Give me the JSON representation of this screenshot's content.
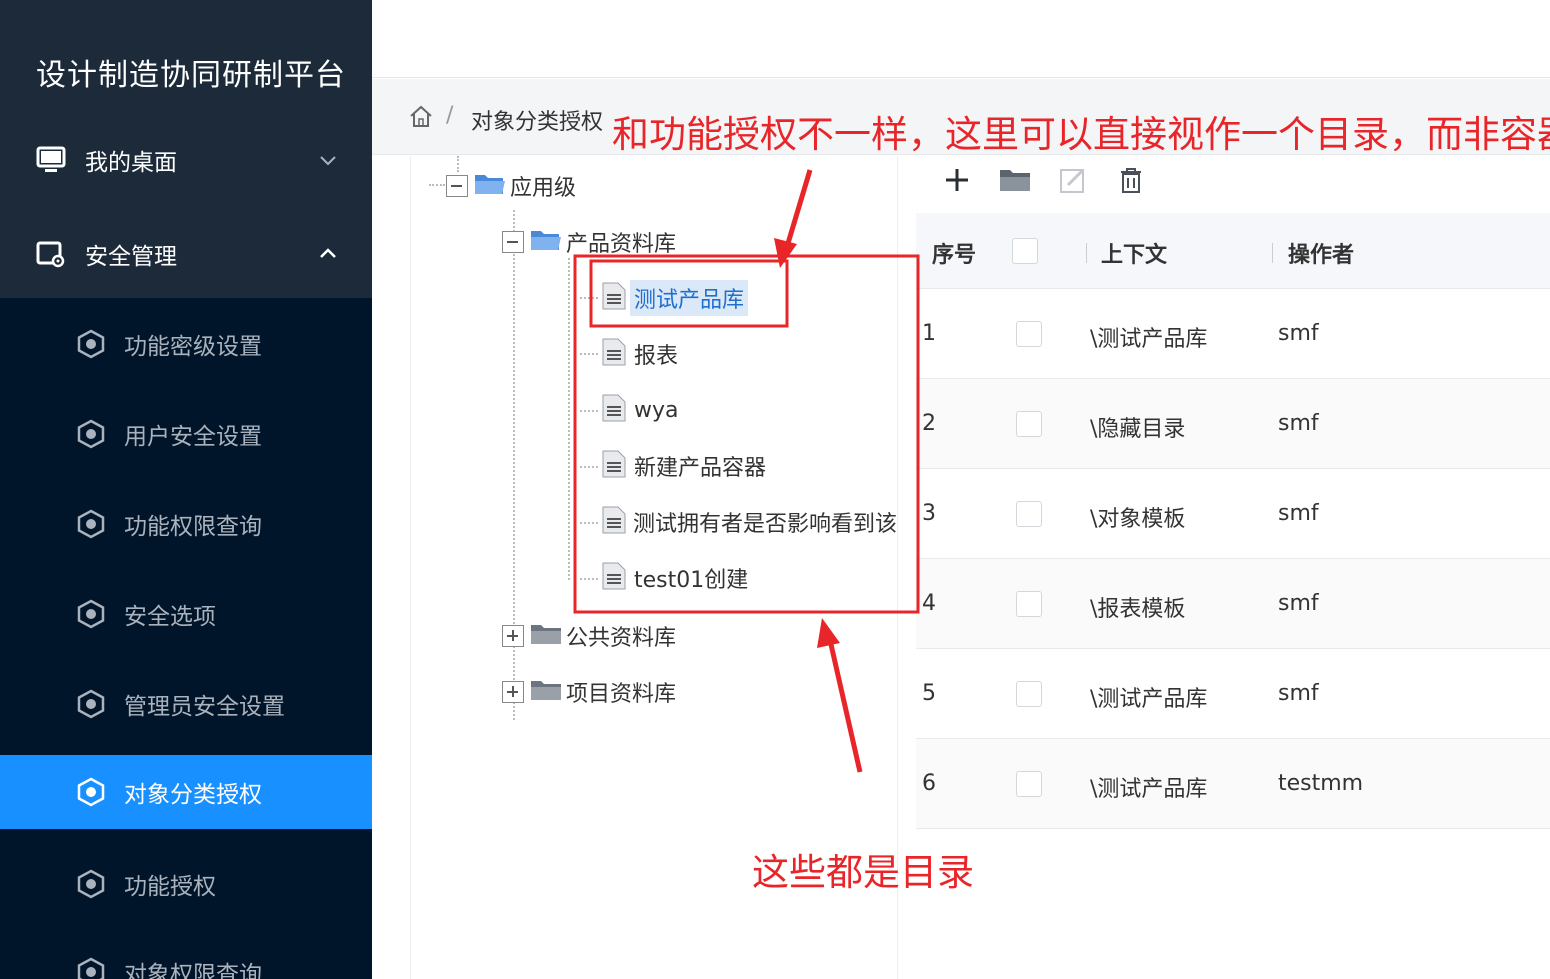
{
  "sidebar": {
    "app_title": "设计制造协同研制平台",
    "groups": [
      {
        "label": "我的桌面",
        "icon": "monitor-icon",
        "state": "collapsed"
      },
      {
        "label": "安全管理",
        "icon": "security-settings-icon",
        "state": "expanded"
      }
    ],
    "items": [
      {
        "label": "功能密级设置",
        "icon": "hexagon-icon",
        "active": false
      },
      {
        "label": "用户安全设置",
        "icon": "hexagon-icon",
        "active": false
      },
      {
        "label": "功能权限查询",
        "icon": "hexagon-icon",
        "active": false
      },
      {
        "label": "安全选项",
        "icon": "hexagon-icon",
        "active": false
      },
      {
        "label": "管理员安全设置",
        "icon": "hexagon-icon",
        "active": false
      },
      {
        "label": "对象分类授权",
        "icon": "hexagon-icon",
        "active": true
      },
      {
        "label": "功能授权",
        "icon": "hexagon-icon",
        "active": false
      },
      {
        "label": "对象权限查询",
        "icon": "hexagon-icon",
        "active": false
      }
    ],
    "active_color": "#1890ff"
  },
  "breadcrumb": {
    "home_icon": "home-icon",
    "separator": "/",
    "current": "对象分类授权"
  },
  "tree": {
    "root": {
      "label": "应用级",
      "icon": "folder-open-icon",
      "expanded": true
    },
    "libraries": [
      {
        "label": "产品资料库",
        "icon": "folder-open-icon",
        "expanded": true
      },
      {
        "label": "公共资料库",
        "icon": "folder-closed-icon",
        "expanded": false
      },
      {
        "label": "项目资料库",
        "icon": "folder-closed-icon",
        "expanded": false
      }
    ],
    "product_children": [
      {
        "label": "测试产品库",
        "selected": true
      },
      {
        "label": "报表",
        "selected": false
      },
      {
        "label": "wya",
        "selected": false
      },
      {
        "label": "新建产品容器",
        "selected": false
      },
      {
        "label": "测试拥有者是否影响看到该",
        "selected": false
      },
      {
        "label": "test01创建",
        "selected": false
      }
    ]
  },
  "toolbar": {
    "buttons": [
      "add-icon",
      "folder-icon",
      "edit-icon",
      "delete-icon"
    ]
  },
  "table": {
    "headers": {
      "index": "序号",
      "context": "上下文",
      "operator": "操作者"
    },
    "rows": [
      {
        "index": "1",
        "context": "\\测试产品库",
        "operator": "smf"
      },
      {
        "index": "2",
        "context": "\\隐藏目录",
        "operator": "smf"
      },
      {
        "index": "3",
        "context": "\\对象模板",
        "operator": "smf"
      },
      {
        "index": "4",
        "context": "\\报表模板",
        "operator": "smf"
      },
      {
        "index": "5",
        "context": "\\测试产品库",
        "operator": "smf"
      },
      {
        "index": "6",
        "context": "\\测试产品库",
        "operator": "testmm"
      }
    ]
  },
  "annotations": {
    "top_note": "和功能授权不一样，这里可以直接视作一个目录，而非容器",
    "bottom_note": "这些都是目录",
    "color": "#e8262a"
  }
}
